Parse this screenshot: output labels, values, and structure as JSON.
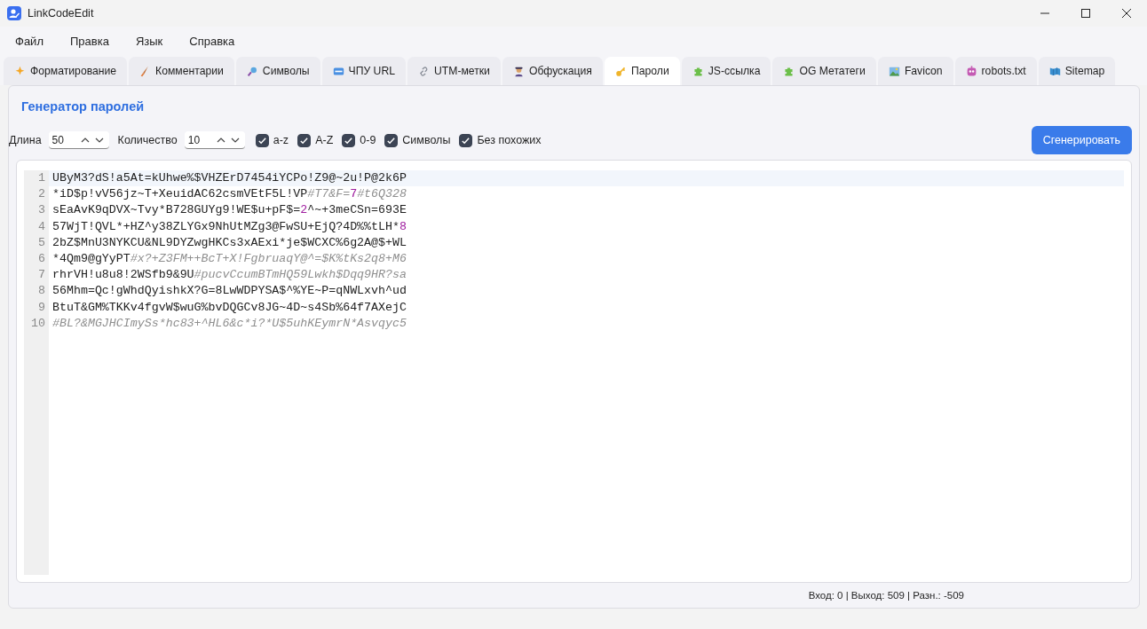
{
  "window": {
    "title": "LinkCodeEdit"
  },
  "menu": [
    "Файл",
    "Правка",
    "Язык",
    "Справка"
  ],
  "tabs": [
    {
      "label": "Форматирование",
      "selected": false
    },
    {
      "label": "Комментарии",
      "selected": false
    },
    {
      "label": "Символы",
      "selected": false
    },
    {
      "label": "ЧПУ URL",
      "selected": false
    },
    {
      "label": "UTM-метки",
      "selected": false
    },
    {
      "label": "Обфускация",
      "selected": false
    },
    {
      "label": "Пароли",
      "selected": true
    },
    {
      "label": "JS-ссылка",
      "selected": false
    },
    {
      "label": "OG Метатеги",
      "selected": false
    },
    {
      "label": "Favicon",
      "selected": false
    },
    {
      "label": "robots.txt",
      "selected": false
    },
    {
      "label": "Sitemap",
      "selected": false
    }
  ],
  "panel": {
    "heading": "Генератор паролей",
    "length": {
      "label": "Длина",
      "value": "50"
    },
    "count": {
      "label": "Количество",
      "value": "10"
    },
    "options": [
      {
        "label": "a-z",
        "checked": true
      },
      {
        "label": "A-Z",
        "checked": true
      },
      {
        "label": "0-9",
        "checked": true
      },
      {
        "label": "Символы",
        "checked": true
      },
      {
        "label": "Без похожих",
        "checked": true
      }
    ],
    "generate_button": "Сгенерировать"
  },
  "editor": {
    "lines": [
      {
        "number": "1",
        "selected": true,
        "segments": [
          {
            "kind": "text",
            "text": "UByM3?dS!a5At=kUhwe%$VHZErD7454iYCPo!Z9@~2u!P@2k6P"
          }
        ]
      },
      {
        "number": "2",
        "selected": false,
        "segments": [
          {
            "kind": "text",
            "text": "*iD$p!vV56jz~T+XeuidAC62csmVEtF5L!VP"
          },
          {
            "kind": "comment",
            "text": "#T7&F="
          },
          {
            "kind": "number",
            "text": "7"
          },
          {
            "kind": "comment",
            "text": "#t6Q328"
          }
        ]
      },
      {
        "number": "3",
        "selected": false,
        "segments": [
          {
            "kind": "text",
            "text": "sEaAvK9qDVX~Tvy*B728GUYg9!WE$u+pF$="
          },
          {
            "kind": "number",
            "text": "2"
          },
          {
            "kind": "text",
            "text": "^~+3meCSn=693E"
          }
        ]
      },
      {
        "number": "4",
        "selected": false,
        "segments": [
          {
            "kind": "text",
            "text": "57WjT!QVL*+HZ^y38ZLYGx9NhUtMZg3@FwSU+EjQ?4D%%tLH*"
          },
          {
            "kind": "number",
            "text": "8"
          }
        ]
      },
      {
        "number": "5",
        "selected": false,
        "segments": [
          {
            "kind": "text",
            "text": "2bZ$MnU3NYKCU&NL9DYZwgHKCs3xAExi*je$WCXC%6g2A@$+WL"
          }
        ]
      },
      {
        "number": "6",
        "selected": false,
        "segments": [
          {
            "kind": "text",
            "text": "*4Qm9@gYyPT"
          },
          {
            "kind": "comment",
            "text": "#x?+Z3FM++BcT+X!FgbruaqY@^=$K%tKs2q8+M6"
          }
        ]
      },
      {
        "number": "7",
        "selected": false,
        "segments": [
          {
            "kind": "text",
            "text": "rhrVH!u8u8!2WSfb9&9U"
          },
          {
            "kind": "comment",
            "text": "#pucvCcumBTmHQ59Lwkh$Dqq9HR?sa"
          }
        ]
      },
      {
        "number": "8",
        "selected": false,
        "segments": [
          {
            "kind": "text",
            "text": "56Mhm=Qc!gWhdQyishkX?G=8LwWDPYSA$^%YE~P=qNWLxvh^ud"
          }
        ]
      },
      {
        "number": "9",
        "selected": false,
        "segments": [
          {
            "kind": "text",
            "text": "BtuT&GM%TKKv4fgvW$wuG%bvDQGCv8JG~4D~s4Sb%64f7AXejC"
          }
        ]
      },
      {
        "number": "10",
        "selected": false,
        "segments": [
          {
            "kind": "comment",
            "text": "#BL?&MGJHCImySs*hc83+^HL6&c*i?*U$5uhKEymrN*Asvqyc5"
          }
        ]
      }
    ]
  },
  "status_bar": "Вход: 0 | Выход: 509 | Разн.: -509"
}
